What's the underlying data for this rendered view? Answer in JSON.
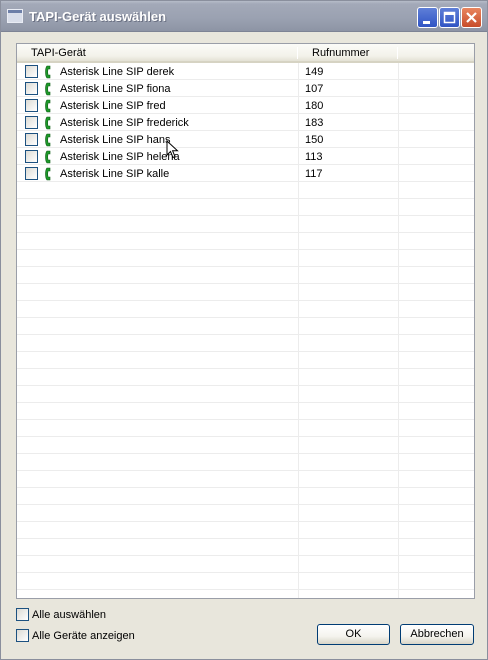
{
  "window": {
    "title": "TAPI-Gerät auswählen"
  },
  "listview": {
    "columns": [
      "TAPI-Gerät",
      "Rufnummer"
    ],
    "rows": [
      {
        "name": "Asterisk Line  SIP derek",
        "number": "149",
        "checked": false,
        "icon": "phone-icon"
      },
      {
        "name": "Asterisk Line  SIP fiona",
        "number": "107",
        "checked": false,
        "icon": "phone-icon"
      },
      {
        "name": "Asterisk Line  SIP fred",
        "number": "180",
        "checked": false,
        "icon": "phone-icon"
      },
      {
        "name": "Asterisk Line  SIP frederick",
        "number": "183",
        "checked": false,
        "icon": "phone-icon"
      },
      {
        "name": "Asterisk Line  SIP hans",
        "number": "150",
        "checked": false,
        "icon": "phone-icon"
      },
      {
        "name": "Asterisk Line  SIP helena",
        "number": "113",
        "checked": false,
        "icon": "phone-icon"
      },
      {
        "name": "Asterisk Line  SIP kalle",
        "number": "117",
        "checked": false,
        "icon": "phone-icon"
      }
    ]
  },
  "options": {
    "select_all": "Alle auswählen",
    "show_all_devices": "Alle Geräte anzeigen"
  },
  "buttons": {
    "ok": "OK",
    "cancel": "Abbrechen"
  },
  "colors": {
    "titlebar": "#9aa1b1",
    "phone_icon": "#1e9a2a",
    "checkbox_border": "#1c5180"
  }
}
